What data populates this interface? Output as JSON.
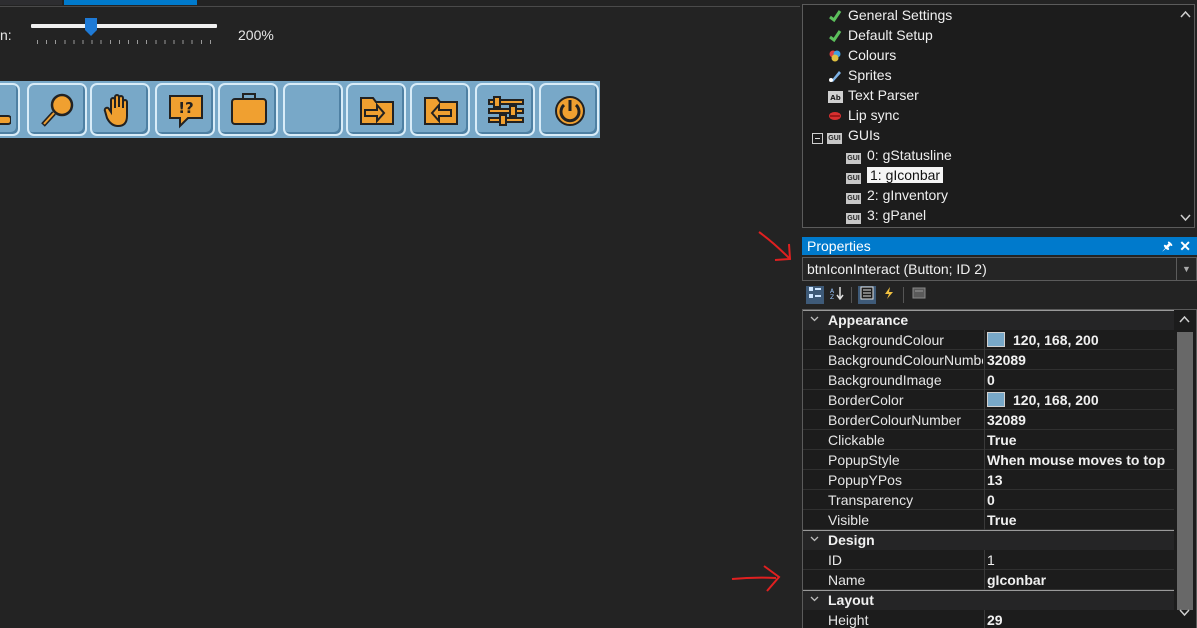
{
  "editor": {
    "zoom_label": "n:",
    "zoom_value": "200%",
    "zoom_percent": 32
  },
  "tree": {
    "items": [
      {
        "label": "General Settings",
        "icon": "check-icon"
      },
      {
        "label": "Default Setup",
        "icon": "check-icon"
      },
      {
        "label": "Colours",
        "icon": "palette-icon"
      },
      {
        "label": "Sprites",
        "icon": "sprite-icon"
      },
      {
        "label": "Text Parser",
        "icon": "text-parser-icon"
      },
      {
        "label": "Lip sync",
        "icon": "lip-sync-icon"
      },
      {
        "label": "GUIs",
        "icon": "gui-icon"
      }
    ],
    "guis": [
      {
        "label": "0: gStatusline"
      },
      {
        "label": "1: gIconbar"
      },
      {
        "label": "2: gInventory"
      },
      {
        "label": "3: gPanel"
      }
    ],
    "gui_icon_text": "GUI"
  },
  "properties": {
    "title": "Properties",
    "selected_object": "btnIconInteract (Button; ID 2)",
    "categories": [
      {
        "name": "Appearance",
        "rows": [
          {
            "name": "BackgroundColour",
            "value": "120, 168, 200"
          },
          {
            "name": "BackgroundColourNumber",
            "value": "32089"
          },
          {
            "name": "BackgroundImage",
            "value": "0"
          },
          {
            "name": "BorderColor",
            "value": "120, 168, 200"
          },
          {
            "name": "BorderColourNumber",
            "value": "32089"
          },
          {
            "name": "Clickable",
            "value": "True"
          },
          {
            "name": "PopupStyle",
            "value": "When mouse moves to top"
          },
          {
            "name": "PopupYPos",
            "value": "13"
          },
          {
            "name": "Transparency",
            "value": "0"
          },
          {
            "name": "Visible",
            "value": "True"
          }
        ]
      },
      {
        "name": "Design",
        "rows": [
          {
            "name": "ID",
            "value": "1"
          },
          {
            "name": "Name",
            "value": "gIconbar"
          }
        ]
      },
      {
        "name": "Layout",
        "rows": [
          {
            "name": "Height",
            "value": "29"
          }
        ]
      }
    ]
  },
  "colors": {
    "accent": "#007acc",
    "iconbar_bg": "#78a8c8",
    "icon_fill": "#f0a030",
    "annotation": "#e02020"
  }
}
